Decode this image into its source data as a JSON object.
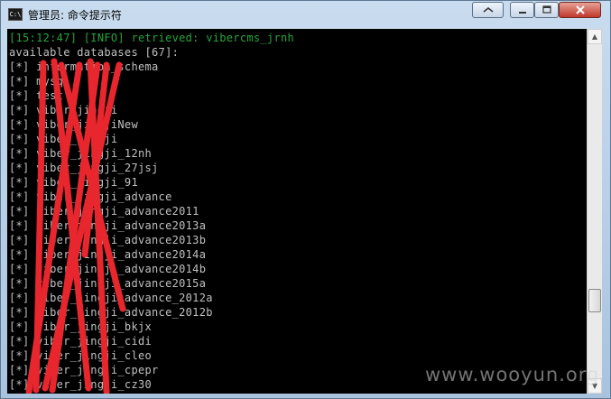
{
  "window": {
    "title": "管理员: 命令提示符",
    "icon_label": "C:\\"
  },
  "controls": {
    "restore_icon": "restore-icon",
    "minimize_icon": "minimize-icon",
    "maximize_icon": "maximize-icon",
    "close_icon": "close-icon"
  },
  "console": {
    "info_line": "[15:12:47] [INFO] retrieved: vibercms_jrnh",
    "header_line": "available databases [67]:",
    "entries": [
      "[*] information_schema",
      "[*] mysql",
      "[*] test",
      "[*] viber_jingji",
      "[*] viber_jingjiNew",
      "[*] viber_jingji",
      "[*] viber_jingji_12nh",
      "[*] viber_jingji_27jsj",
      "[*] viber_jingji_91",
      "[*] viber_jingji_advance",
      "[*] viber_jingji_advance2011",
      "[*] viber_jingji_advance2013a",
      "[*] viber_jingji_advance2013b",
      "[*] viber_jingji_advance2014a",
      "[*] viber_jingji_advance2014b",
      "[*] viber_jingji_advance2015a",
      "[*] viber_jingji_advance_2012a",
      "[*] viber_jingji_advance_2012b",
      "[*] viber_jingji_bkjx",
      "[*] viber_jingji_cidi",
      "[*] viber_jingji_cleo",
      "[*] viber_jingji_cpepr",
      "[*] viber_jingji_cz30"
    ],
    "info_color": "#25a53a",
    "text_color": "#c0c0c0",
    "redaction_color": "#e8262d"
  },
  "watermark": "www.wooyun.org"
}
